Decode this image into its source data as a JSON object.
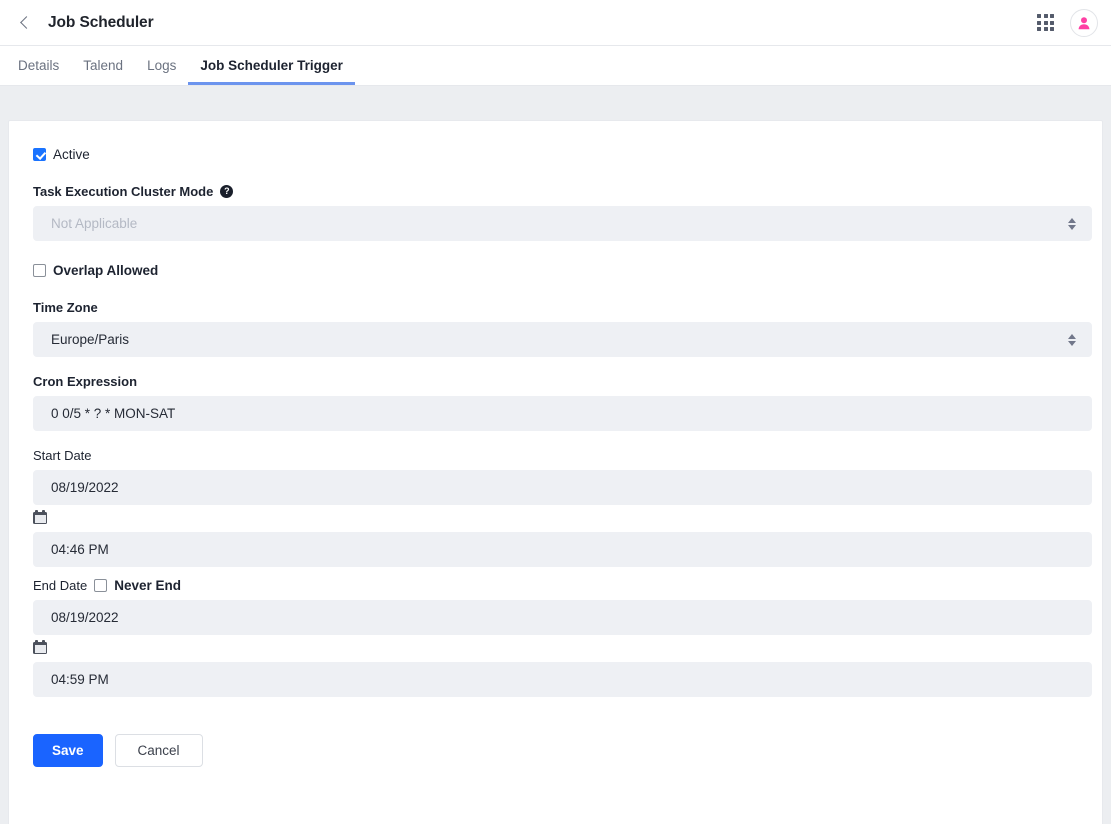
{
  "header": {
    "back_icon": "chevron-left-icon",
    "title": "Job Scheduler",
    "apps_icon": "grid-apps-icon",
    "avatar_icon": "user-avatar-icon"
  },
  "tabs": [
    {
      "label": "Details",
      "active": false
    },
    {
      "label": "Talend",
      "active": false
    },
    {
      "label": "Logs",
      "active": false
    },
    {
      "label": "Job Scheduler Trigger",
      "active": true
    }
  ],
  "form": {
    "active": {
      "label": "Active",
      "checked": true
    },
    "cluster_mode": {
      "label": "Task Execution Cluster Mode",
      "help_icon": "question-mark-icon",
      "value": "Not Applicable",
      "disabled": true
    },
    "overlap_allowed": {
      "label": "Overlap Allowed",
      "checked": false
    },
    "time_zone": {
      "label": "Time Zone",
      "value": "Europe/Paris"
    },
    "cron_expression": {
      "label": "Cron Expression",
      "value": "0 0/5 * ? * MON-SAT"
    },
    "start_date": {
      "label": "Start Date",
      "date_value": "08/19/2022",
      "calendar_icon": "calendar-icon",
      "time_value": "04:46 PM"
    },
    "end_date": {
      "label": "End Date",
      "never_end_label": "Never End",
      "never_end_checked": false,
      "date_value": "08/19/2022",
      "calendar_icon": "calendar-icon",
      "time_value": "04:59 PM"
    }
  },
  "actions": {
    "save_label": "Save",
    "cancel_label": "Cancel"
  },
  "colors": {
    "accent_blue": "#1a64ff",
    "tab_underline": "#6c94ee",
    "avatar_pink": "#ff3fa4",
    "page_background": "#eceef1",
    "field_background": "#eef0f4"
  }
}
